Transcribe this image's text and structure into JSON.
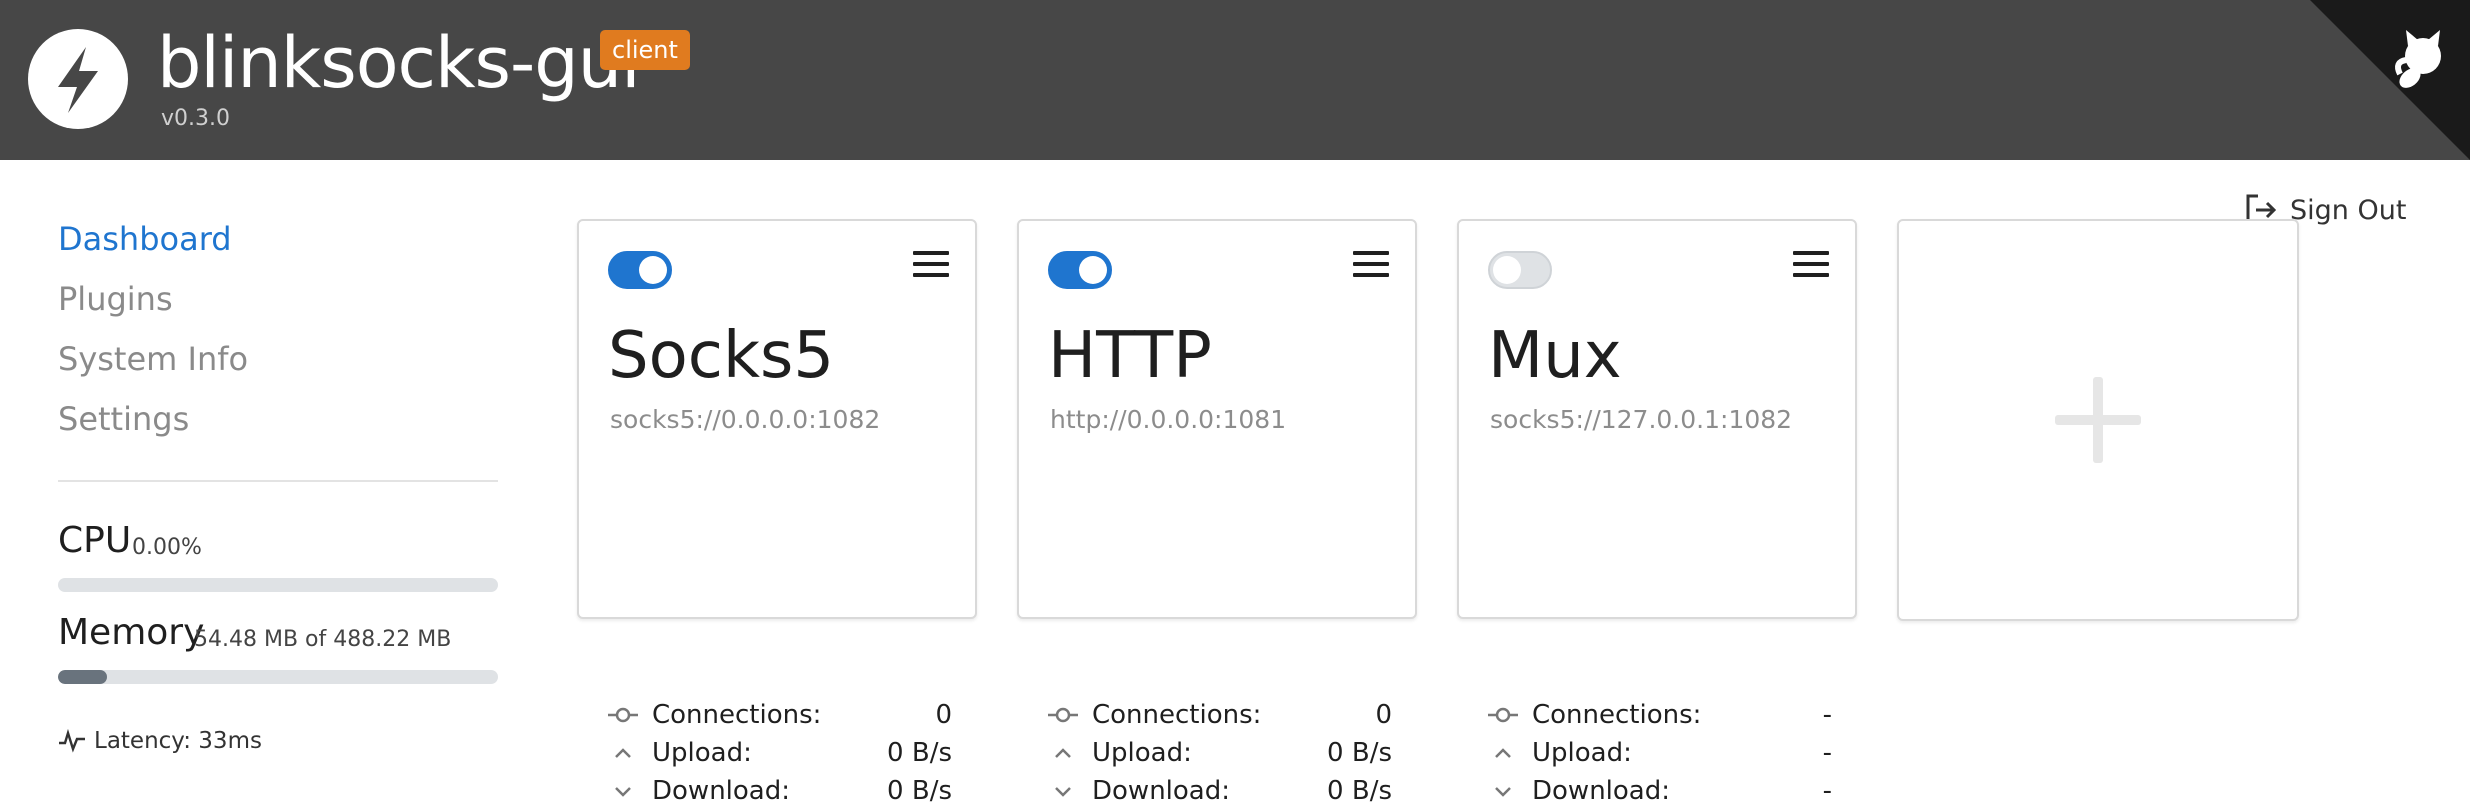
{
  "header": {
    "app_title": "blinksocks-gui",
    "mode_badge": "client",
    "version": "v0.3.0"
  },
  "signout": {
    "label": "Sign Out"
  },
  "sidebar": {
    "nav": [
      {
        "label": "Dashboard",
        "active": true
      },
      {
        "label": "Plugins",
        "active": false
      },
      {
        "label": "System Info",
        "active": false
      },
      {
        "label": "Settings",
        "active": false
      }
    ],
    "cpu": {
      "title": "CPU",
      "value": "0.00%",
      "fraction": 0.0
    },
    "memory": {
      "title": "Memory",
      "value": "54.48 MB of 488.22 MB",
      "fraction": 0.1116
    },
    "latency": "Latency: 33ms"
  },
  "services": [
    {
      "name": "Socks5",
      "address": "socks5://0.0.0.0:1082",
      "enabled": true,
      "connections_label": "Connections:",
      "connections": "0",
      "upload_label": "Upload:",
      "upload": "0 B/s",
      "download_label": "Download:",
      "download": "0 B/s"
    },
    {
      "name": "HTTP",
      "address": "http://0.0.0.0:1081",
      "enabled": true,
      "connections_label": "Connections:",
      "connections": "0",
      "upload_label": "Upload:",
      "upload": "0 B/s",
      "download_label": "Download:",
      "download": "0 B/s"
    },
    {
      "name": "Mux",
      "address": "socks5://127.0.0.1:1082",
      "enabled": false,
      "connections_label": "Connections:",
      "connections": "-",
      "upload_label": "Upload:",
      "upload": "-",
      "download_label": "Download:",
      "download": "-"
    }
  ],
  "icons": {
    "logo": "lightning-bolt-icon",
    "corner": "github-octocat-icon",
    "signout": "sign-out-icon",
    "latency": "pulse-icon",
    "connections": "commit-icon",
    "upload": "chevron-up-icon",
    "download": "chevron-down-icon",
    "add": "plus-icon",
    "menu": "hamburger-menu-icon"
  },
  "colors": {
    "header_bg": "#474747",
    "accent": "#1f75cf",
    "badge": "#e07b1f"
  }
}
